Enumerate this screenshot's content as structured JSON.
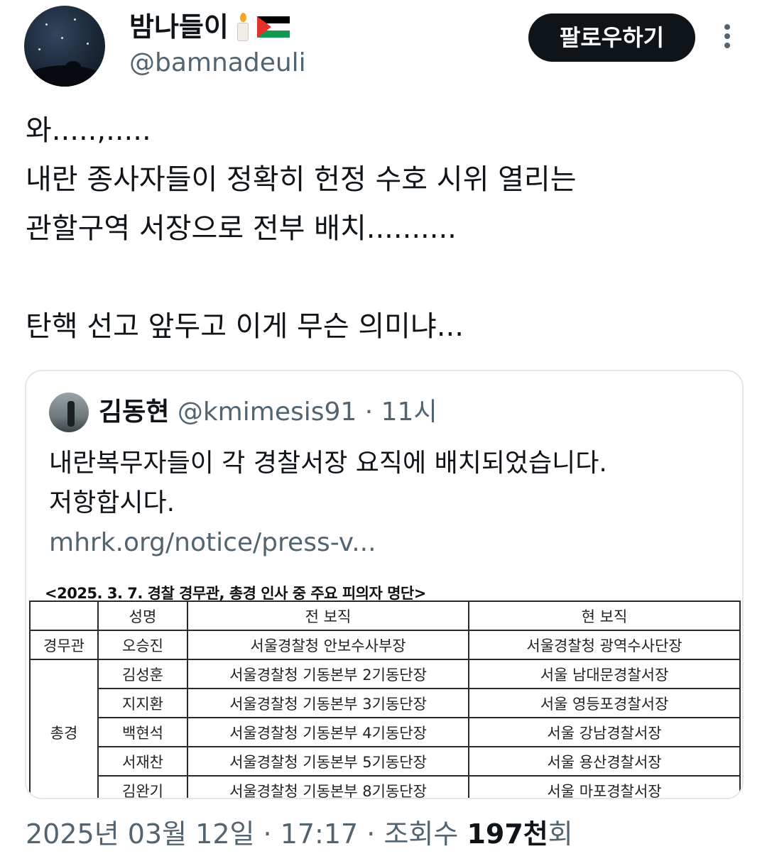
{
  "author": {
    "display_name": "밤나들이",
    "emoji_icons": [
      "candle-icon",
      "palestine-flag-icon"
    ],
    "handle": "@bamnadeuli"
  },
  "follow_button_label": "팔로우하기",
  "tweet_lines": [
    "와.....,.....",
    "내란 종사자들이 정확히 헌정 수호 시위 열리는",
    "관할구역 서장으로 전부 배치..........",
    "",
    "탄핵 선고 앞두고 이게 무슨 의미냐..."
  ],
  "quote": {
    "name": "김동현",
    "handle": "@kmimesis91",
    "separator": " · ",
    "time": "11시",
    "text_lines": [
      "내란복무자들이 각 경찰서장 요직에 배치되었습니다.",
      "저항합시다."
    ],
    "link": "mhrk.org/notice/press-v...",
    "image": {
      "title": "<2025. 3. 7. 경찰 경무관, 총경 인사 중 주요 피의자 명단>",
      "headers": [
        "",
        "성명",
        "전 보직",
        "현 보직"
      ],
      "rank_gyeongmugwan": "경무관",
      "rank_chonggyeong": "총경",
      "rows": [
        {
          "name": "오승진",
          "prev": "서울경찰청 안보수사부장",
          "curr": "서울경찰청 광역수사단장"
        },
        {
          "name": "김성훈",
          "prev": "서울경찰청 기동본부 2기동단장",
          "curr": "서울 남대문경찰서장"
        },
        {
          "name": "지지환",
          "prev": "서울경찰청 기동본부 3기동단장",
          "curr": "서울 영등포경찰서장"
        },
        {
          "name": "백현석",
          "prev": "서울경찰청 기동본부 4기동단장",
          "curr": "서울 강남경찰서장"
        },
        {
          "name": "서재찬",
          "prev": "서울경찰청 기동본부 5기동단장",
          "curr": "서울 용산경찰서장"
        },
        {
          "name": "김완기",
          "prev": "서울경찰청 기동본부 8기동단장",
          "curr": "서울 마포경찰서장"
        }
      ]
    }
  },
  "timestamp": {
    "date": "2025년 03월 12일",
    "separator": " · ",
    "time": "17:17",
    "views_label": "조회수 ",
    "views_count": "197천",
    "views_suffix": "회"
  },
  "colors": {
    "text_primary": "#0f1419",
    "text_secondary": "#536471",
    "button_bg": "#0f1419",
    "border": "#e1e8ed"
  }
}
